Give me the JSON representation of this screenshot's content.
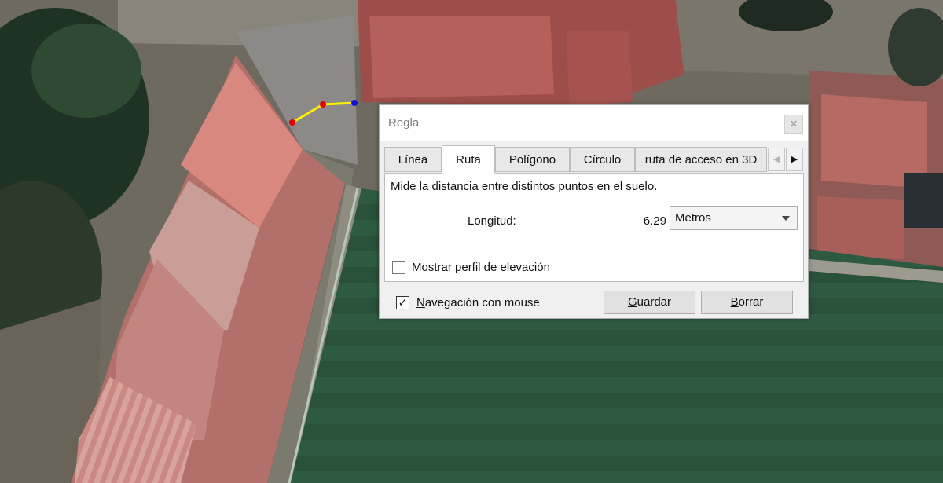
{
  "dialog": {
    "title": "Regla",
    "close_glyph": "✕",
    "tabs": [
      {
        "label": "Línea",
        "active": false
      },
      {
        "label": "Ruta",
        "active": true
      },
      {
        "label": "Polígono",
        "active": false
      },
      {
        "label": "Círculo",
        "active": false
      },
      {
        "label": "ruta de acceso en 3D",
        "active": false
      }
    ],
    "tab_scroll": {
      "left_glyph": "◀",
      "right_glyph": "▶"
    },
    "panel": {
      "description": "Mide la distancia entre distintos puntos en el suelo.",
      "length_label": "Longitud:",
      "length_value": "6.29",
      "unit_selected": "Metros",
      "elevation_checkbox_label": "Mostrar perfil de elevación",
      "elevation_checked": false
    },
    "mouse_nav": {
      "label_accel": "N",
      "label_rest": "avegación con mouse",
      "checked": true,
      "check_glyph": "✓"
    },
    "buttons": {
      "save_accel": "G",
      "save_rest": "uardar",
      "clear_accel": "B",
      "clear_rest": "orrar"
    }
  },
  "measurement_path": {
    "line_color": "#ffee00",
    "point_colors": [
      "#e00000",
      "#e00000",
      "#1010e0"
    ]
  },
  "icons": [
    "close-icon",
    "tab-scroll-left-icon",
    "tab-scroll-right-icon",
    "dropdown-caret-icon",
    "checkmark-icon"
  ]
}
